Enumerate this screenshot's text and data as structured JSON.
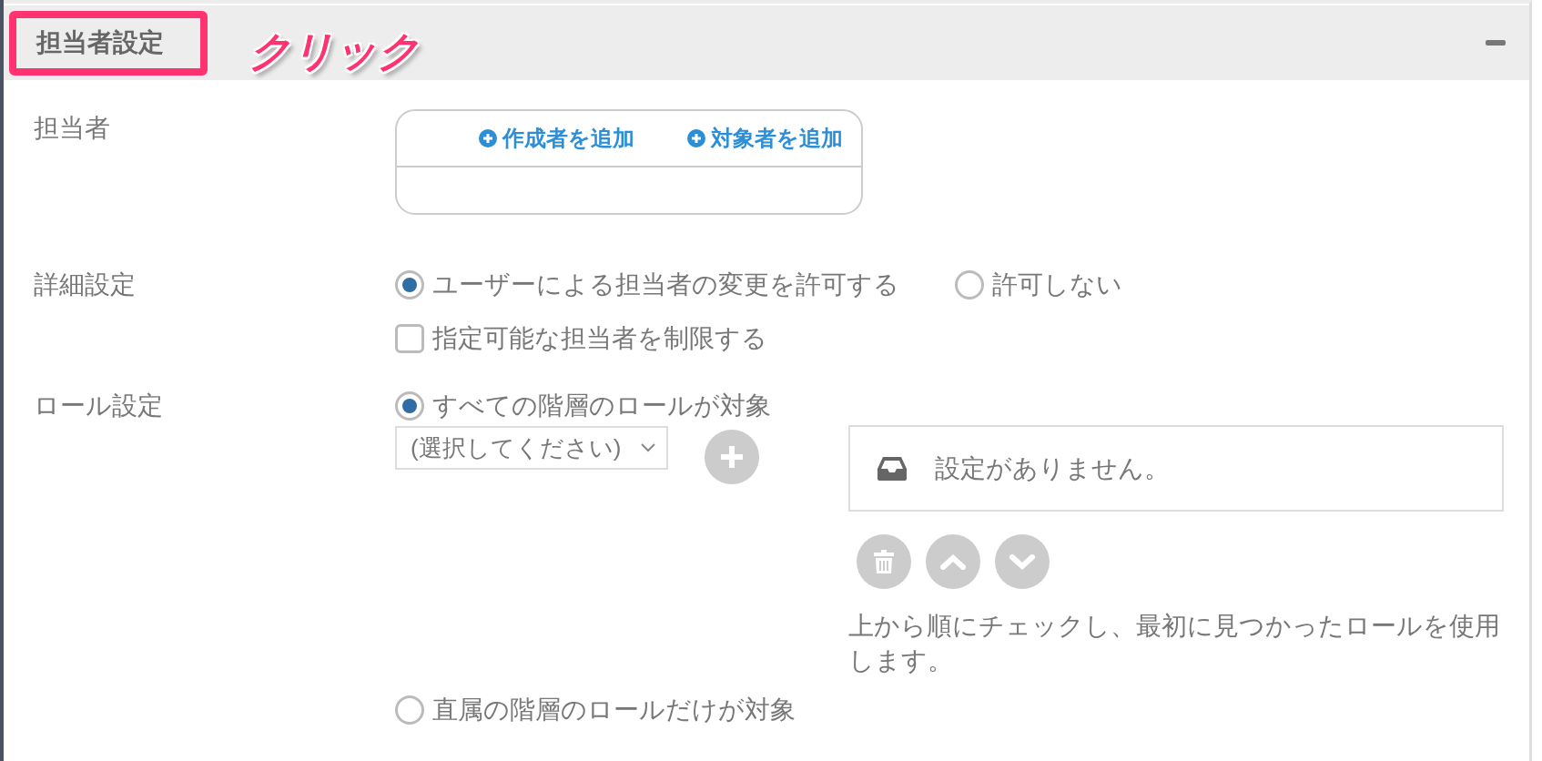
{
  "section": {
    "title": "担当者設定",
    "expanded": true
  },
  "annotation": {
    "label": "クリック",
    "frame_on_title": true
  },
  "assignee": {
    "label": "担当者",
    "add_links": [
      "作成者を追加",
      "対象者を追加"
    ]
  },
  "details": {
    "label": "詳細設定",
    "permission": [
      {
        "label": "ユーザーによる担当者の変更を許可する",
        "selected": true
      },
      {
        "label": "許可しない",
        "selected": false
      }
    ],
    "restrict": {
      "label": "指定可能な担当者を制限する",
      "checked": false
    }
  },
  "roles": {
    "label": "ロール設定",
    "scope": [
      {
        "label": "すべての階層のロールが対象",
        "selected": true
      },
      {
        "label": "直属の階層のロールだけが対象",
        "selected": false
      }
    ],
    "select": {
      "value": "(選択してください)"
    },
    "role_list": {
      "empty_message": "設定がありません。"
    },
    "help_text": "上から順にチェックし、最初に見つかったロールを使用します。"
  }
}
